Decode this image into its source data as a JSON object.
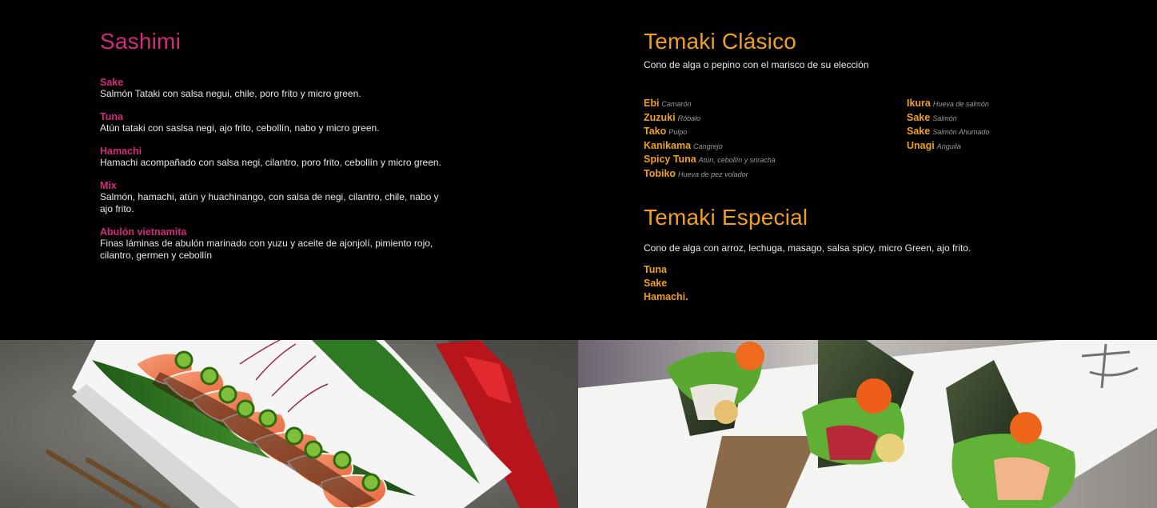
{
  "sashimi": {
    "title": "Sashimi",
    "items": [
      {
        "name": "Sake",
        "desc": "Salmón Tataki con salsa negui, chile, poro frito y micro green."
      },
      {
        "name": "Tuna",
        "desc": "Atún tataki con saslsa negi, ajo frito, cebollín, nabo y micro green."
      },
      {
        "name": "Hamachi",
        "desc": "Hamachi acompañado con salsa negi, cilantro, poro frito, cebollín y micro green."
      },
      {
        "name": "Mix",
        "desc": "Salmón, hamachi, atún y huachinango, con salsa de negi, cilantro, chile, nabo y ajo frito."
      },
      {
        "name": "Abulón vietnamita",
        "desc": "Finas láminas de abulón marinado con yuzu y aceite de ajonjolí, pimiento rojo, cilantro, germen y cebollín"
      }
    ]
  },
  "temaki_clasico": {
    "title": "Temaki Clásico",
    "subtitle": "Cono de alga o pepino con el marisco de su elección",
    "col1": [
      {
        "name": "Ebi",
        "sub": "Camarón"
      },
      {
        "name": "Zuzuki",
        "sub": "Róbalo"
      },
      {
        "name": "Tako",
        "sub": "Pulpo"
      },
      {
        "name": "Kanikama",
        "sub": "Cangrejo"
      },
      {
        "name": "Spicy Tuna",
        "sub": "Atún, cebollín y sriracha"
      },
      {
        "name": "Tobiko",
        "sub": "Hueva de pez volador"
      }
    ],
    "col2": [
      {
        "name": "Ikura",
        "sub": "Hueva de salmón"
      },
      {
        "name": "Sake",
        "sub": "Salmón"
      },
      {
        "name": "Sake",
        "sub": "Salmón Ahumado"
      },
      {
        "name": "Unagi",
        "sub": "Anguila"
      }
    ]
  },
  "temaki_especial": {
    "title": "Temaki Especial",
    "subtitle": "Cono de alga con arroz, lechuga, masago, salsa spicy, micro Green, ajo frito.",
    "items": [
      "Tuna",
      "Sake",
      "Hamachi."
    ]
  }
}
